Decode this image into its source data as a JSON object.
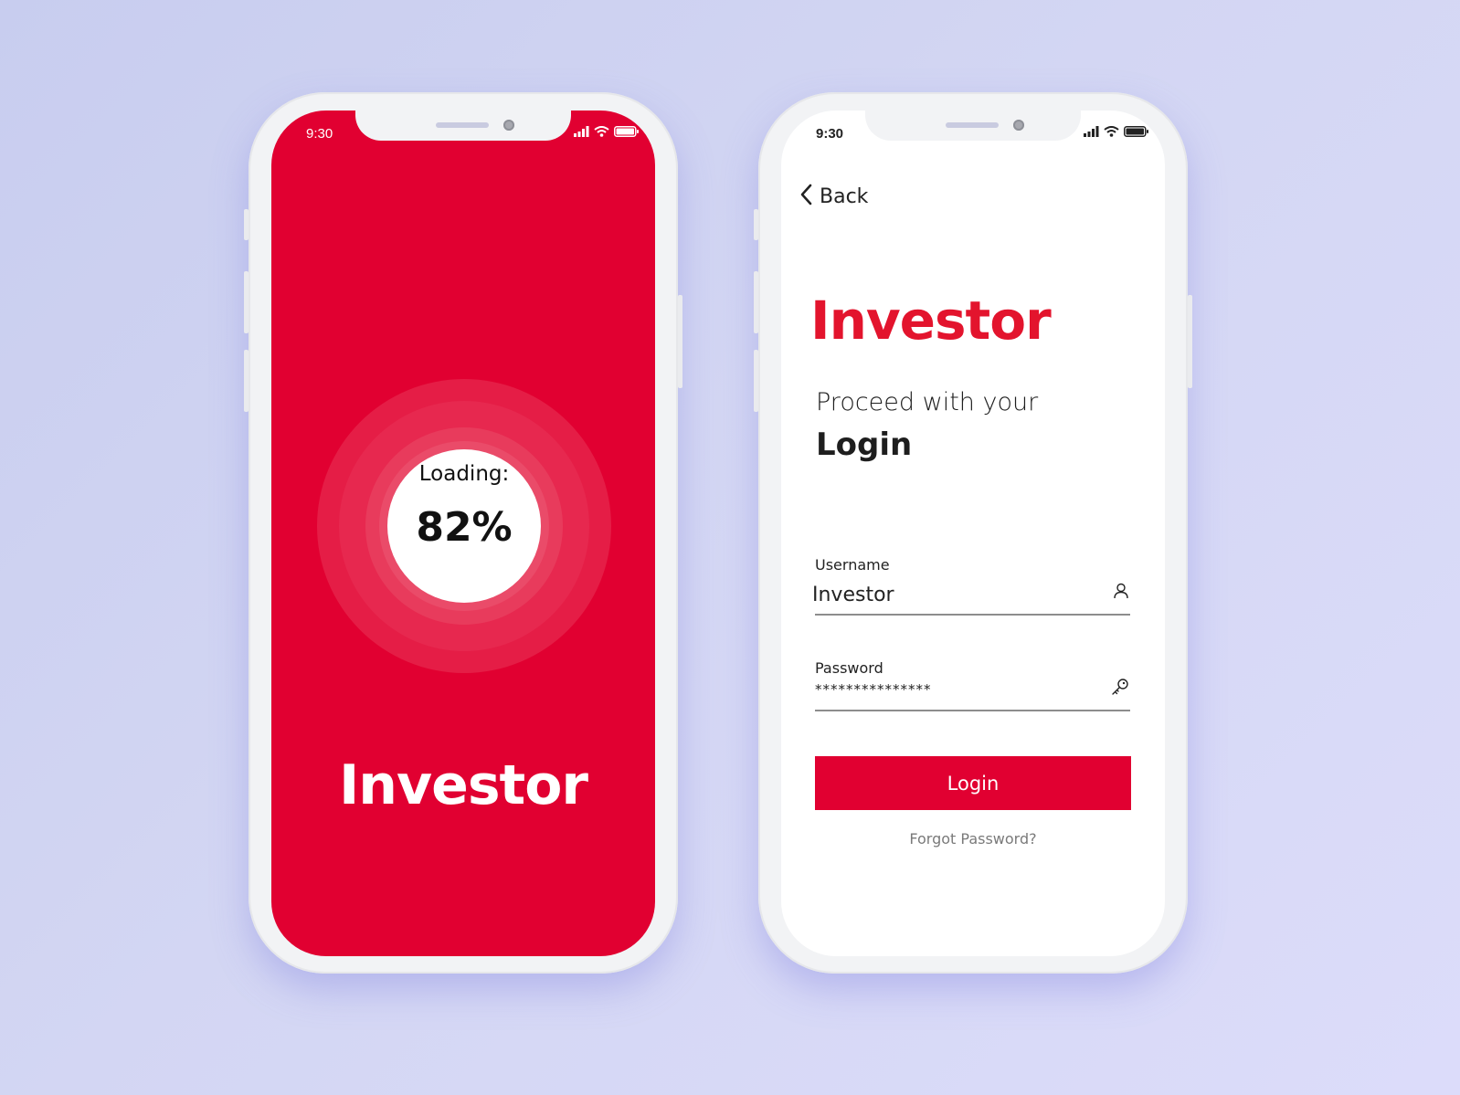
{
  "colors": {
    "brand_red": "#e10031",
    "brand_text_red": "#e3142d",
    "background": "#d3d6f3",
    "phone_frame": "#f2f3f5"
  },
  "splash_screen": {
    "status_bar": {
      "time": "9:30",
      "icons": [
        "signal-icon",
        "wifi-icon",
        "battery-icon"
      ]
    },
    "loader": {
      "label": "Loading:",
      "percent_text": "82%",
      "progress": 0.82
    },
    "title": "Investor"
  },
  "login_screen": {
    "status_bar": {
      "time": "9:30",
      "icons": [
        "signal-icon",
        "wifi-icon",
        "battery-icon"
      ]
    },
    "back_label": "Back",
    "brand": "Investor",
    "subtitle": "Proceed with your",
    "heading": "Login",
    "username": {
      "label": "Username",
      "value": "Investor",
      "icon": "user-icon"
    },
    "password": {
      "label": "Password",
      "value": "***************",
      "icon": "key-icon"
    },
    "login_button": "Login",
    "forgot_password": "Forgot Password?"
  }
}
